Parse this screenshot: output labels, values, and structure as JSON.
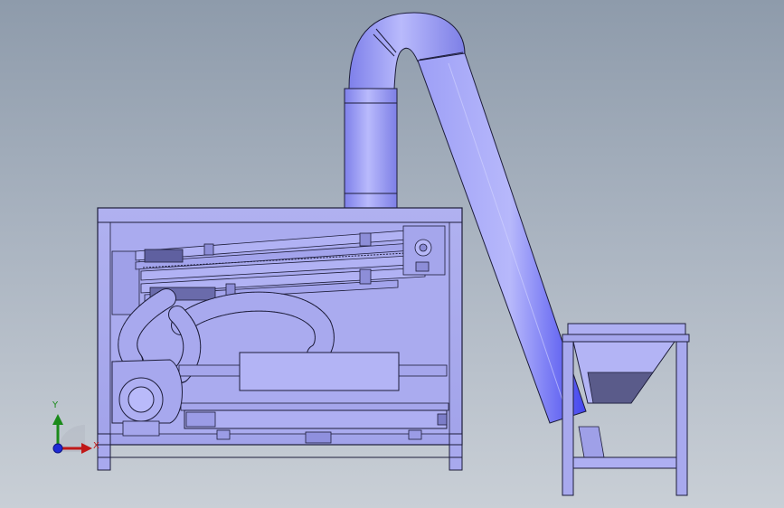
{
  "view": {
    "title": "",
    "background_top": "#8e9bab",
    "background_bottom": "#c9cfd6"
  },
  "model": {
    "body_color": "#a8a9ee",
    "body_stroke": "#1d1d3a",
    "duct_color": "#8f90f2",
    "duct_highlight": "#c7c8ff",
    "hopper_shadow": "#5a5b8a"
  },
  "triad": {
    "y_label": "Y",
    "x_label": "X",
    "y_color": "#1a8a1a",
    "x_color": "#c01818",
    "z_color": "#1e2ad6",
    "icon": "coordinate-triad-icon"
  }
}
